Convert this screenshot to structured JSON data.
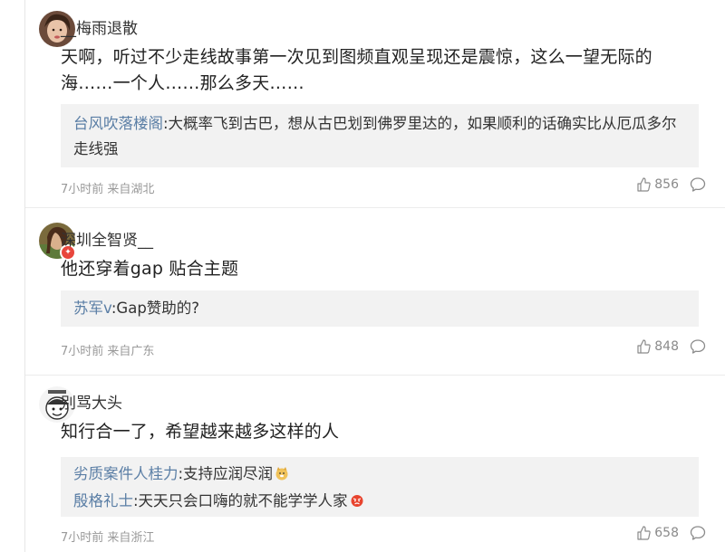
{
  "comments": [
    {
      "username": "__梅雨退散",
      "content": "天啊，听过不少走线故事第一次见到图频直观呈现还是震惊，这么一望无际的海……一个人……那么多天……",
      "replies": [
        {
          "author": "台风吹落楼阁",
          "text": ":大概率飞到古巴，想从古巴划到佛罗里达的，如果顺利的话确实比从厄瓜多尔走线强"
        }
      ],
      "time": "7小时前 来自湖北",
      "likes": "856"
    },
    {
      "username": "深圳全智贤__",
      "content": "他还穿着gap 贴合主题",
      "replies": [
        {
          "author": "苏军v",
          "text": ":Gap赞助的?"
        }
      ],
      "time": "7小时前 来自广东",
      "likes": "848"
    },
    {
      "username": "别骂大头",
      "content": "知行合一了，希望越来越多这样的人",
      "replies": [
        {
          "author": "劣质案件人桂力",
          "text": ":支持应润尽润"
        },
        {
          "author": "殷格礼士",
          "text": ":天天只会口嗨的就不能学学人家"
        }
      ],
      "time": "7小时前 来自浙江",
      "likes": "658"
    }
  ],
  "icons": {
    "like": "thumbs-up-icon",
    "reply": "comment-bubble-icon"
  },
  "colors": {
    "reply_author": "#5a7ea5",
    "meta": "#999999",
    "reply_bg": "#f2f2f2"
  }
}
